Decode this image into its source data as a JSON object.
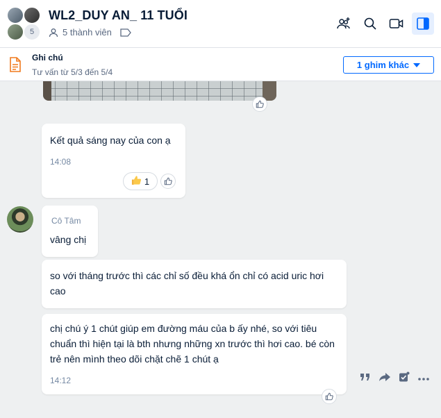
{
  "header": {
    "title": "WL2_DUY AN_ 11 TUỔI",
    "member_count_badge": "5",
    "members_label": "5 thành viên"
  },
  "pinned": {
    "title": "Ghi chú",
    "subtitle": "Tư vấn từ 5/3 đến 5/4",
    "more_button": "1 ghim khác"
  },
  "messages": [
    {
      "text": "Kết quả sáng nay của con ạ",
      "time": "14:08",
      "reaction_count": "1"
    },
    {
      "sender": "Cô Tâm",
      "text": "vâng chị"
    },
    {
      "text": "so với tháng trước thì các chỉ số đều khá ổn chỉ có acid uric hơi cao"
    },
    {
      "text": "chị chú ý 1 chút giúp em đường máu của b ấy nhé, so với tiêu chuẩn thì hiện tại là bth nhưng những xn trước thì hơi cao. bé còn trẻ nên mình theo dõi chặt chẽ 1 chút ạ",
      "time": "14:12"
    }
  ],
  "colors": {
    "accent": "#0068ff",
    "background": "#eef0f1",
    "note_icon": "#f07a1d"
  },
  "icons": [
    "add-member-icon",
    "search-icon",
    "video-call-icon",
    "sidebar-toggle-icon",
    "note-icon",
    "like-icon",
    "quote-icon",
    "share-icon",
    "task-icon",
    "more-icon"
  ]
}
